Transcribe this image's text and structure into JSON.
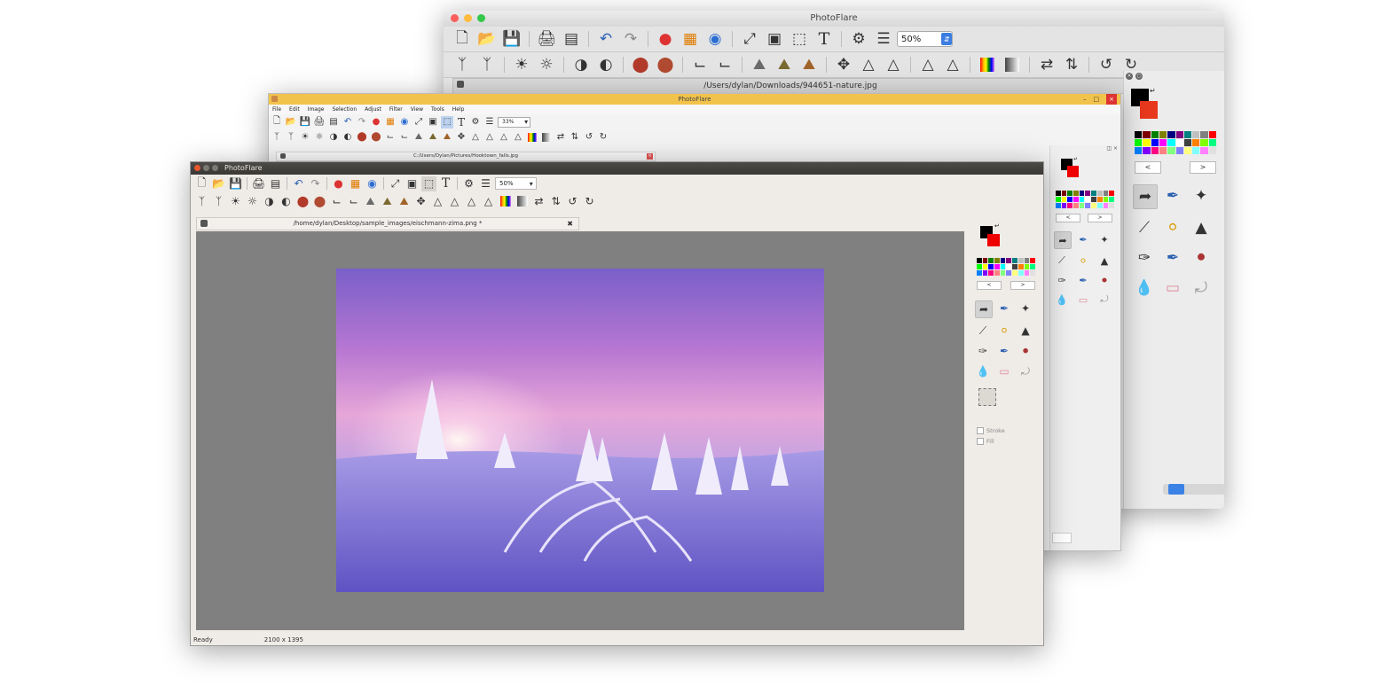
{
  "colors": {
    "accent_blue": "#3b7de0",
    "win_title": "#f2c34c",
    "ubuntu_title": "#3d3b38",
    "canvas_gray": "#808080"
  },
  "toolbar_icons_row1": [
    "new-file-icon",
    "open-folder-icon",
    "save-icon",
    "print-icon",
    "scanner-icon",
    "undo-icon",
    "redo-icon",
    "color-balance-icon",
    "mosaic-icon",
    "hue-icon",
    "line-tool-icon",
    "crop-icon",
    "selection-crop-icon",
    "text-icon",
    "settings-icon",
    "layers-icon"
  ],
  "toolbar_icons_row2": [
    "auto-level-icon",
    "contrast-icon",
    "brightness-up-icon",
    "brightness-down-icon",
    "invert-icon",
    "grayscale-icon",
    "red-filter-icon",
    "sepia-icon",
    "shear-left-icon",
    "shear-right-icon",
    "landscape-icon",
    "landscape2-icon",
    "landscape3-icon",
    "move-icon",
    "triangle-icon",
    "triangle2-icon",
    "triangle3-icon",
    "triangle4-icon",
    "gradient-icon",
    "gradient2-icon",
    "flip-icon",
    "flip2-icon",
    "rotate-ccw-icon",
    "rotate-cw-icon"
  ],
  "windows": {
    "mac": {
      "title": "PhotoFlare",
      "zoom": "50%",
      "tab_path": "/Users/dylan/Downloads/944651-nature.jpg",
      "nav_prev": "<",
      "nav_next": ">"
    },
    "win": {
      "title": "PhotoFlare",
      "menu": [
        "File",
        "Edit",
        "Image",
        "Selection",
        "Adjust",
        "Filter",
        "View",
        "Tools",
        "Help"
      ],
      "zoom": "33%",
      "tab_path": "C:/Users/Dylan/Pictures/Hooktown_falls.jpg",
      "nav_prev": "<",
      "nav_next": ">",
      "ctrl_min": "–",
      "ctrl_max": "□",
      "ctrl_close": "×"
    },
    "ubuntu": {
      "title": "PhotoFlare",
      "zoom": "50%",
      "tab_path": "/home/dylan/Desktop/sample_images/eischmann-zima.png *",
      "tab_close": "✖",
      "nav_prev": "<",
      "nav_next": ">",
      "stroke_label": "Stroke",
      "fill_label": "Fill",
      "status": "Ready",
      "dimensions": "2100 x 1395"
    }
  },
  "palette": [
    "#000000",
    "#800000",
    "#008000",
    "#808000",
    "#000080",
    "#800080",
    "#008080",
    "#c0c0c0",
    "#808080",
    "#ff0000",
    "#00ff00",
    "#ffff00",
    "#0000ff",
    "#ff00ff",
    "#00ffff",
    "#ffffff",
    "#404040",
    "#ff8000",
    "#80ff00",
    "#00ff80",
    "#0080ff",
    "#8000ff",
    "#ff0080",
    "#ff8080",
    "#80ff80",
    "#8080ff",
    "#ffff80",
    "#80ffff",
    "#ff80ff",
    "#e0e0e0"
  ],
  "tools": [
    "pointer-icon",
    "eyedropper-icon",
    "magic-wand-icon",
    "line-icon",
    "paint-bucket-icon",
    "spray-icon",
    "brush-icon",
    "clone-icon",
    "stamp-icon",
    "drop-icon",
    "eraser-icon",
    "lasso-icon"
  ]
}
